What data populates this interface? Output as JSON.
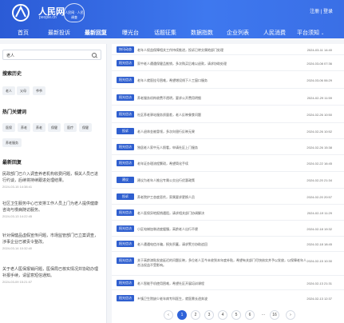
{
  "header": {
    "logo_text": "人民网",
    "logo_sub": "people.cn",
    "badge_text": "人民网 · 人民调查",
    "login": "注册 | 登录"
  },
  "nav": [
    {
      "label": "首页",
      "active": false
    },
    {
      "label": "最新投诉",
      "active": false
    },
    {
      "label": "最新回复",
      "active": true
    },
    {
      "label": "曝光台",
      "active": false
    },
    {
      "label": "话题征集",
      "active": false
    },
    {
      "label": "数据指数",
      "active": false
    },
    {
      "label": "企业列表",
      "active": false
    },
    {
      "label": "人民消费",
      "active": false
    },
    {
      "label": "平台须知",
      "active": false,
      "caret": "⌄"
    }
  ],
  "sidebar": {
    "search_value": "老人",
    "history_title": "搜索历史",
    "history": [
      "老人",
      "父母",
      "爷爷"
    ],
    "hot_title": "热门关键词",
    "hot": [
      "医保",
      "养老",
      "养老",
      "保健",
      "医疗",
      "保健",
      "养老服务"
    ],
    "recent_title": "最新回复",
    "recent": [
      {
        "text": "民政部门已介入调查养老机构收费问题，相关人员已进行约谈，后续将持续跟进处理结果。",
        "date": "2024-03-15 14:38:41"
      },
      {
        "text": "社区卫生服务中心已安排工作人员上门为老人提供健康咨询与慢病随访服务。",
        "date": "2024-03-13 14:22:45"
      },
      {
        "text": "针对保健品虚假宣传问题，市场监管部门已立案调查，涉事企业已被责令整改。",
        "date": "2024-03-14 10:32:40"
      },
      {
        "text": "关于老人医保报销问题，医保局已核实情况并协助办理补报手续，请留意短信通知。",
        "date": "2024-03-09 15:21:07"
      }
    ]
  },
  "list": [
    {
      "tag": "快讯动态",
      "title": "老年人权益保障相关工作持续推进，投诉已转交属地部门处理",
      "date": "2024-03-11 14:40"
    },
    {
      "tag": "阳光信访",
      "title": "家中老人遭遇保健品推销，多次购买后难以退款，请求协助处理",
      "date": "2024-03-08 07:36"
    },
    {
      "tag": "阳光信访",
      "title": "老年人就医挂号困难，希望增设线下人工窗口服务",
      "date": "2024-03-06 06:29"
    },
    {
      "tag": "阳光信访",
      "title": "养老服务机构收费不透明，要求公开费用明细",
      "date": "2024-02-29 11:59"
    },
    {
      "tag": "阳光信访",
      "title": "社区养老驿站服务质量差，老人反映餐食问题",
      "date": "2024-02-26 10:50"
    },
    {
      "tag": "投诉",
      "title": "老人退休金被冒领，多次向银行反映无果",
      "date": "2024-02-26 10:52"
    },
    {
      "tag": "阳光信访",
      "title": "独居老人家中无人照看，申请社区上门服务",
      "date": "2024-02-26 15:38"
    },
    {
      "tag": "阳光信访",
      "title": "老年证办理流程繁琐，希望简化手续",
      "date": "2024-02-22 16:45"
    },
    {
      "tag": "建议",
      "title": "建议为老年人推出专属公交出行优惠政策",
      "date": "2024-02-20 21:34"
    },
    {
      "tag": "投诉",
      "title": "养老院护工态度恶劣，家属要求更换人员",
      "date": "2024-02-20 20:57"
    },
    {
      "tag": "阳光信访",
      "title": "老人医保异地报销遇阻，请求相关部门协调解决",
      "date": "2024-02-19 11:29"
    },
    {
      "tag": "阳光信访",
      "title": "小区电梯加装进度缓慢，高龄老人出行不便",
      "date": "2024-02-18 19:32"
    },
    {
      "tag": "阳光信访",
      "title": "老人遭遇电信诈骗，损失积蓄，请求警方协助追回",
      "date": "2024-02-18 18:45"
    },
    {
      "tag": "阳光信访",
      "title": "关于高龄津贴发放延迟的问题反映，多位老人至今未收到本年度补贴，希望有关部门尽快核实并予以发放，以保障老年人合法权益不受影响。",
      "date": "2024-02-15 10:30",
      "wrap": true
    },
    {
      "tag": "阳光信访",
      "title": "老人智能手机使用困难，希望社区开展培训课程",
      "date": "2024-02-13 21:31"
    },
    {
      "tag": "阳光信访",
      "title": "乡镇卫生院缺少老年病专科医生，就医需长途奔波",
      "date": "2024-02-13 12:37"
    }
  ],
  "pager": {
    "prev": "‹",
    "pages": [
      "1",
      "2",
      "3",
      "4",
      "5",
      "6",
      "...",
      "16"
    ],
    "next": "›",
    "current": "1"
  },
  "colors": {
    "accent": "#2f63d9",
    "header": "#3e78ef",
    "tag": "#2f5fcf"
  }
}
